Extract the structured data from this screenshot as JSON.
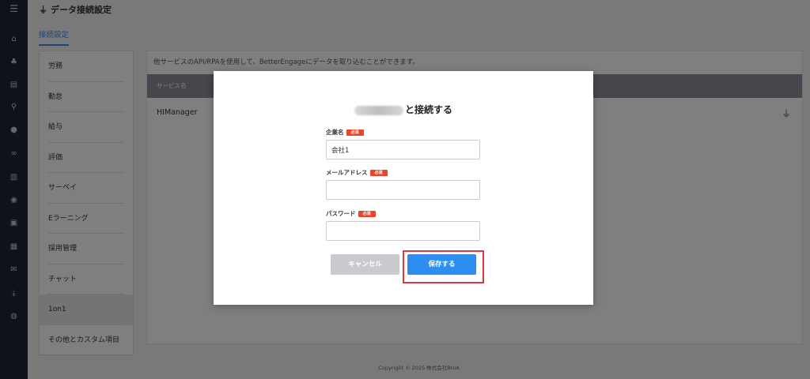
{
  "sidebar": {
    "icons": [
      "menu-icon",
      "home-icon",
      "sitemap-icon",
      "document-icon",
      "search-icon",
      "chat-icon",
      "link-icon",
      "chart-icon",
      "globe-icon",
      "contact-icon",
      "book-icon",
      "mail-icon",
      "download-icon",
      "user-settings-icon"
    ],
    "glyphs": [
      "☰",
      "⌂",
      "♣",
      "▤",
      "⚲",
      "●",
      "∞",
      "▥",
      "◉",
      "▣",
      "▦",
      "✉",
      "⤓",
      "◍"
    ]
  },
  "header": {
    "title": "データ接続設定",
    "plug_glyph": "⏚"
  },
  "tabs": {
    "active": "接続設定"
  },
  "categories": [
    "労務",
    "勤怠",
    "給与",
    "評価",
    "サーベイ",
    "Eラーニング",
    "採用管理",
    "チャット",
    "1on1",
    "その他とカスタム項目"
  ],
  "panel": {
    "description": "他サービスのAPI/RPAを使用して、BetterEngageにデータを取り込むことができます。",
    "column_header": "サービス名",
    "row_service": "HIManager",
    "row_plug_glyph": "⏚"
  },
  "footer": {
    "copyright": "Copyright © 2025 株式会社BtoA"
  },
  "modal": {
    "title_suffix": "と接続する",
    "company_label": "企業名",
    "company_value": "会社1",
    "email_label": "メールアドレス",
    "email_value": "",
    "password_label": "パスワード",
    "password_value": "",
    "required_badge": "必須",
    "cancel_label": "キャンセル",
    "save_label": "保存する"
  },
  "colors": {
    "accent": "#2d8ef0",
    "required": "#e8452c",
    "highlight": "#e0383e",
    "rail": "#1f2733"
  }
}
